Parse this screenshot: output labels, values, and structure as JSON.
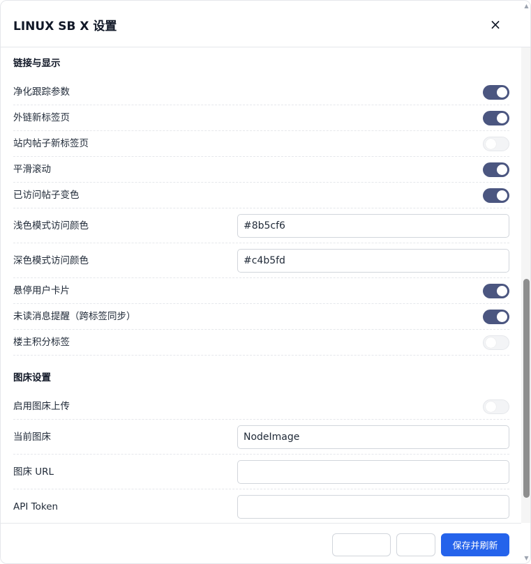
{
  "dialog": {
    "title": "LINUX SB X 设置",
    "close_icon": "close-icon",
    "close_glyph": "×"
  },
  "sections": {
    "links": {
      "title": "链接与显示",
      "rows": [
        {
          "label": "净化跟踪参数",
          "type": "toggle",
          "on": true
        },
        {
          "label": "外链新标签页",
          "type": "toggle",
          "on": true
        },
        {
          "label": "站内帖子新标签页",
          "type": "toggle",
          "on": false
        },
        {
          "label": "平滑滚动",
          "type": "toggle",
          "on": true
        },
        {
          "label": "已访问帖子变色",
          "type": "toggle",
          "on": true
        },
        {
          "label": "浅色模式访问颜色",
          "type": "input",
          "value": "#8b5cf6"
        },
        {
          "label": "深色模式访问颜色",
          "type": "input",
          "value": "#c4b5fd"
        },
        {
          "label": "悬停用户卡片",
          "type": "toggle",
          "on": true
        },
        {
          "label": "未读消息提醒（跨标签同步）",
          "type": "toggle",
          "on": true
        },
        {
          "label": "楼主积分标签",
          "type": "toggle",
          "on": false
        }
      ]
    },
    "image_host": {
      "title": "图床设置",
      "rows": [
        {
          "label": "启用图床上传",
          "type": "toggle",
          "on": false
        },
        {
          "label": "当前图床",
          "type": "input",
          "value": "NodeImage"
        },
        {
          "label": "图床 URL",
          "type": "input",
          "value": ""
        },
        {
          "label": "API Token",
          "type": "input",
          "value": ""
        }
      ]
    }
  },
  "footer": {
    "reset_label": "",
    "cancel_label": "",
    "save_label": "保存并刷新"
  },
  "colors": {
    "toggle_on": "#4b5680",
    "toggle_off": "#f3f4f6",
    "primary": "#2563eb"
  }
}
